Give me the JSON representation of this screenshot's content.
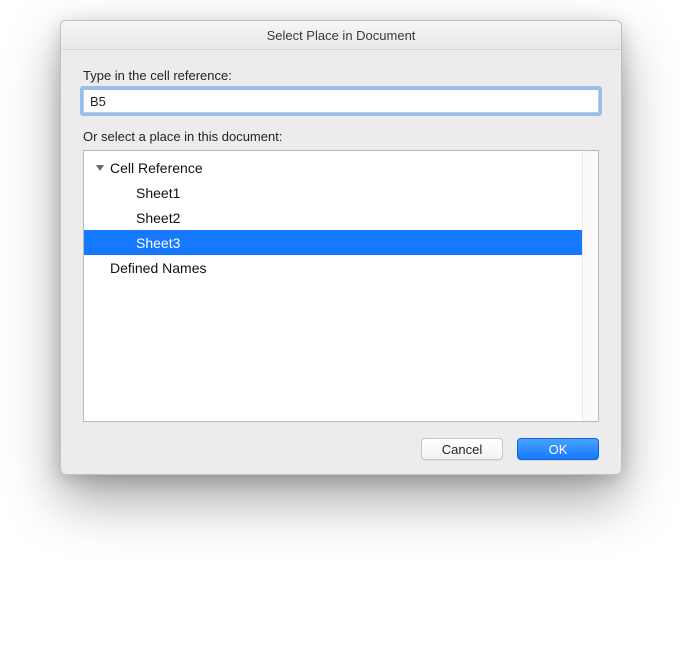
{
  "dialog": {
    "title": "Select Place in Document",
    "cell_ref_label": "Type in the cell reference:",
    "cell_ref_value": "B5",
    "place_label": "Or select a place in this document:",
    "tree": {
      "cell_reference_group": "Cell Reference",
      "sheets": [
        "Sheet1",
        "Sheet2",
        "Sheet3"
      ],
      "selected_sheet_index": 2,
      "defined_names_group": "Defined Names"
    },
    "buttons": {
      "cancel": "Cancel",
      "ok": "OK"
    }
  }
}
